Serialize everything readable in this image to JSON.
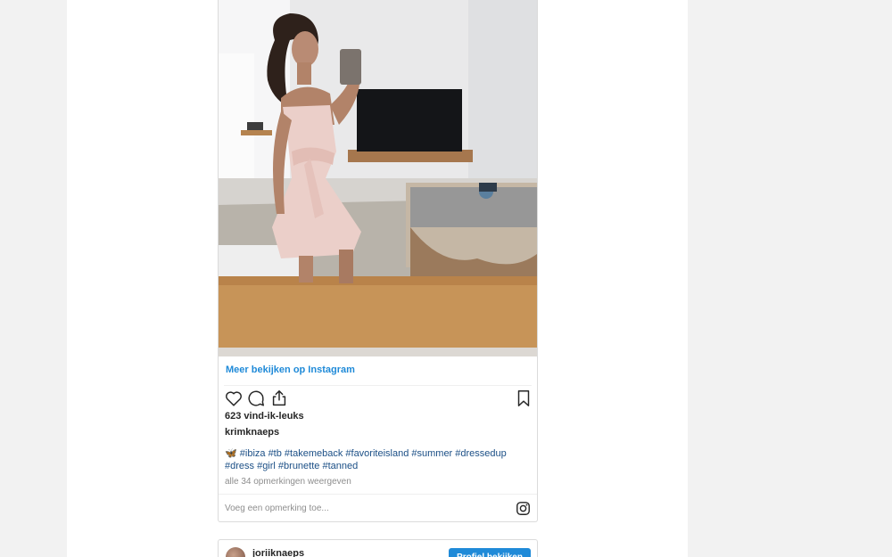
{
  "post": {
    "view_more_label": "Meer bekijken op Instagram",
    "likes_text": "623 vind-ik-leuks",
    "author": "krimknaeps",
    "caption_emoji": "🦋",
    "caption_hashtags": "#ibiza #tb #takemeback #favoriteisland #summer #dressedup #dress #girl #brunette #tanned",
    "view_comments_label": "alle 34 opmerkingen weergeven",
    "comment_placeholder": "Voeg een opmerking toe..."
  },
  "icons": {
    "like": "heart-icon",
    "comment": "comment-icon",
    "share": "share-icon",
    "save": "bookmark-icon",
    "instagram": "instagram-icon"
  },
  "next_post": {
    "username": "joriiknaeps",
    "profile_button_label": "Profiel bekijken"
  },
  "colors": {
    "link_blue": "#1f8ad8",
    "hashtag_blue": "#1b4f86",
    "muted_text": "#8e8e8e",
    "page_background": "#f2f2f2"
  }
}
